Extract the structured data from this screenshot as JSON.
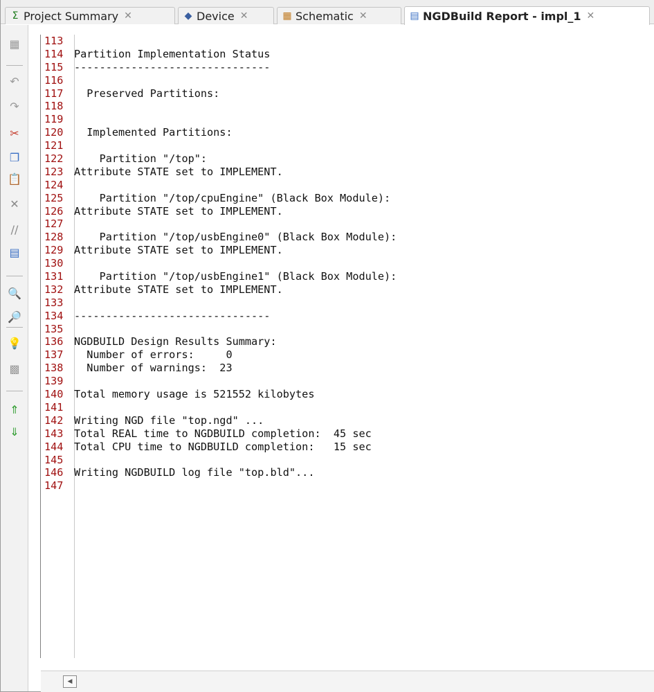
{
  "tabs": [
    {
      "icon": "Σ",
      "icon_name": "sigma-icon",
      "label": "Project Summary",
      "active": false
    },
    {
      "icon": "◆",
      "icon_name": "device-icon",
      "label": "Device",
      "active": false
    },
    {
      "icon": "▦",
      "icon_name": "schematic-icon",
      "label": "Schematic",
      "active": false
    },
    {
      "icon": "▤",
      "icon_name": "document-icon",
      "label": "NGDBuild Report - impl_1",
      "active": true
    }
  ],
  "toolbar": {
    "icons": [
      {
        "name": "save-icon",
        "glyph": "▦",
        "color": "#9a9a9a"
      },
      {
        "name": "undo-icon",
        "glyph": "↶",
        "color": "#9a9a9a"
      },
      {
        "name": "redo-icon",
        "glyph": "↷",
        "color": "#9a9a9a"
      },
      {
        "name": "cut-icon",
        "glyph": "✂",
        "color": "#c43a2a"
      },
      {
        "name": "copy-icon",
        "glyph": "❐",
        "color": "#3a6fc4"
      },
      {
        "name": "paste-icon",
        "glyph": "📋",
        "color": "#c49a2a"
      },
      {
        "name": "delete-icon",
        "glyph": "✕",
        "color": "#8a8a8a"
      },
      {
        "name": "comment-icon",
        "glyph": "//",
        "color": "#8a8a8a"
      },
      {
        "name": "select-all-icon",
        "glyph": "▤",
        "color": "#3a6fc4"
      },
      {
        "name": "find-icon",
        "glyph": "🔍",
        "color": "#3a6fc4"
      },
      {
        "name": "find-in-files-icon",
        "glyph": "🔎",
        "color": "#3a6fc4"
      },
      {
        "name": "lightbulb-icon",
        "glyph": "💡",
        "color": "#e0b000"
      },
      {
        "name": "bookmark-icon",
        "glyph": "▩",
        "color": "#9a9a9a"
      },
      {
        "name": "go-to-top-icon",
        "glyph": "⇑",
        "color": "#2a9a2a"
      },
      {
        "name": "go-to-bottom-icon",
        "glyph": "⇓",
        "color": "#2a9a2a"
      }
    ]
  },
  "editor": {
    "highlight_color": "#ffff80",
    "highlight_lines": [
      114,
      134
    ],
    "lines": [
      {
        "n": "113",
        "text": ""
      },
      {
        "n": "114",
        "text": "Partition Implementation Status"
      },
      {
        "n": "115",
        "text": "-------------------------------"
      },
      {
        "n": "116",
        "text": ""
      },
      {
        "n": "117",
        "text": "  Preserved Partitions:"
      },
      {
        "n": "118",
        "text": ""
      },
      {
        "n": "119",
        "text": ""
      },
      {
        "n": "120",
        "text": "  Implemented Partitions:"
      },
      {
        "n": "121",
        "text": ""
      },
      {
        "n": "122",
        "text": "    Partition \"/top\":"
      },
      {
        "n": "123",
        "text": "Attribute STATE set to IMPLEMENT."
      },
      {
        "n": "124",
        "text": ""
      },
      {
        "n": "125",
        "text": "    Partition \"/top/cpuEngine\" (Black Box Module):"
      },
      {
        "n": "126",
        "text": "Attribute STATE set to IMPLEMENT."
      },
      {
        "n": "127",
        "text": ""
      },
      {
        "n": "128",
        "text": "    Partition \"/top/usbEngine0\" (Black Box Module):"
      },
      {
        "n": "129",
        "text": "Attribute STATE set to IMPLEMENT."
      },
      {
        "n": "130",
        "text": ""
      },
      {
        "n": "131",
        "text": "    Partition \"/top/usbEngine1\" (Black Box Module):"
      },
      {
        "n": "132",
        "text": "Attribute STATE set to IMPLEMENT."
      },
      {
        "n": "133",
        "text": ""
      },
      {
        "n": "134",
        "text": "-------------------------------"
      },
      {
        "n": "135",
        "text": ""
      },
      {
        "n": "136",
        "text": "NGDBUILD Design Results Summary:"
      },
      {
        "n": "137",
        "text": "  Number of errors:     0"
      },
      {
        "n": "138",
        "text": "  Number of warnings:  23"
      },
      {
        "n": "139",
        "text": ""
      },
      {
        "n": "140",
        "text": "Total memory usage is 521552 kilobytes"
      },
      {
        "n": "141",
        "text": ""
      },
      {
        "n": "142",
        "text": "Writing NGD file \"top.ngd\" ..."
      },
      {
        "n": "143",
        "text": "Total REAL time to NGDBUILD completion:  45 sec"
      },
      {
        "n": "144",
        "text": "Total CPU time to NGDBUILD completion:   15 sec"
      },
      {
        "n": "145",
        "text": ""
      },
      {
        "n": "146",
        "text": "Writing NGDBUILD log file \"top.bld\"..."
      },
      {
        "n": "147",
        "text": ""
      }
    ]
  },
  "scrollbar": {
    "left_arrow": "◀"
  }
}
